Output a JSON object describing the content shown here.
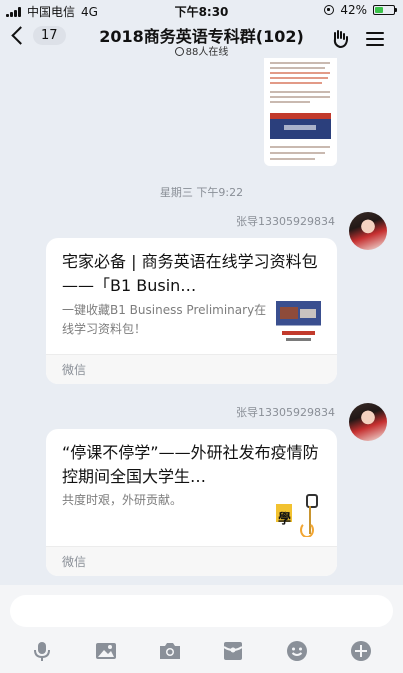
{
  "status_bar": {
    "carrier": "中国电信",
    "network": "4G",
    "time": "下午8:30",
    "battery_percent": "42%",
    "battery_level": 0.42
  },
  "nav": {
    "back_count": "17",
    "title": "2018商务英语专科群(102)",
    "online": "88人在线"
  },
  "chat": {
    "timestamp": "星期三 下午9:22",
    "messages": [
      {
        "sender": "张导13305929834",
        "title": "宅家必备 | 商务英语在线学习资料包 ——「B1 Busin…",
        "desc": "一键收藏B1 Business Preliminary在线学习资料包！",
        "source": "微信"
      },
      {
        "sender": "张导13305929834",
        "title": "“停课不停学”——外研社发布疫情防控期间全国大学生…",
        "desc": "共度时艰，外研贡献。",
        "source": "微信"
      }
    ]
  },
  "toolbar": {
    "icons": [
      "microphone-icon",
      "image-icon",
      "camera-icon",
      "red-packet-icon",
      "emoji-icon",
      "plus-icon"
    ]
  },
  "colors": {
    "background": "#e9edf3",
    "card": "#ffffff",
    "battery": "#3bc24a",
    "meta_text": "#8a8f97"
  }
}
